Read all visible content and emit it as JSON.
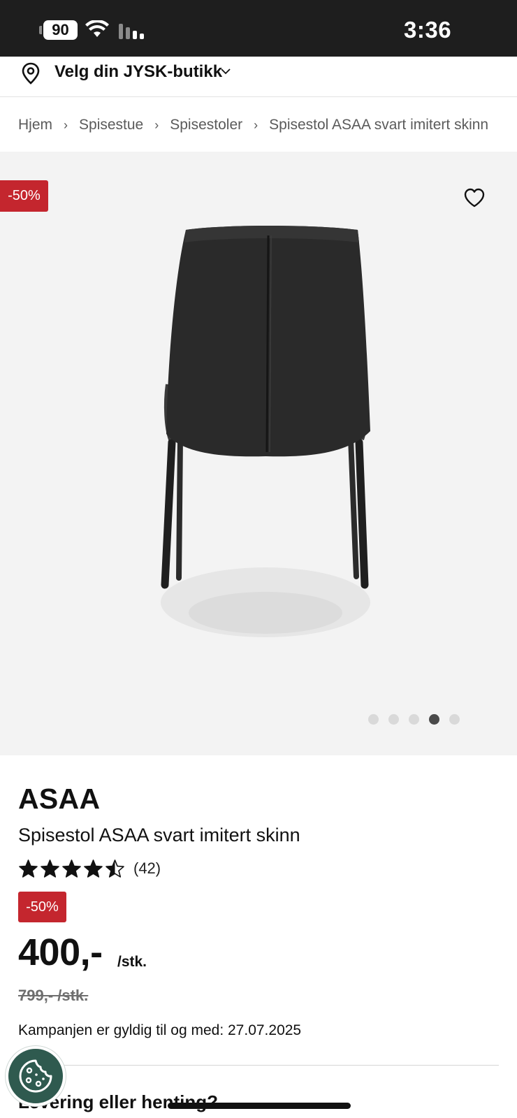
{
  "status_bar": {
    "battery": "90",
    "time": "3:36"
  },
  "store_bar": {
    "label": "Velg din JYSK-butikk"
  },
  "breadcrumb": {
    "items": [
      "Hjem",
      "Spisestue",
      "Spisestoler",
      "Spisestol ASAA svart imitert skinn"
    ],
    "separator": "›"
  },
  "gallery": {
    "discount_badge": "-50%",
    "image_count": 5,
    "active_image_index": 3
  },
  "product": {
    "brand": "ASAA",
    "name": "Spisestol ASAA svart imitert skinn",
    "rating": 4.5,
    "rating_max": 5,
    "review_count": "(42)",
    "discount_badge": "-50%",
    "price": "400,-",
    "unit": "/stk.",
    "old_price": "799,- /stk.",
    "campaign_text": "Kampanjen er gyldig til og med: 27.07.2025"
  },
  "delivery": {
    "heading": "Levering eller henting?"
  },
  "colors": {
    "discount": "#c4262e",
    "cookie_button": "#2f5a4f",
    "status_bar": "#1e1e1e"
  }
}
